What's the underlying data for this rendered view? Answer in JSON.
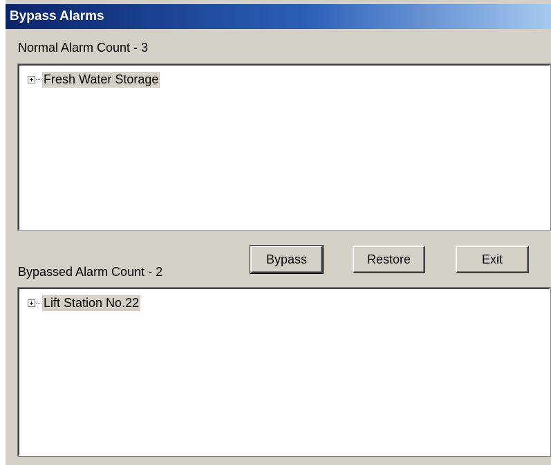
{
  "window": {
    "title": "Bypass Alarms"
  },
  "normal": {
    "label": "Normal Alarm Count - 3",
    "items": [
      {
        "label": "Fresh Water Storage"
      }
    ]
  },
  "bypassed": {
    "label": "Bypassed Alarm Count - 2",
    "items": [
      {
        "label": "Lift Station No.22"
      }
    ]
  },
  "buttons": {
    "bypass_label": "Bypass",
    "restore_label": "Restore",
    "exit_label": "Exit"
  },
  "colors": {
    "titlebar_start": "#0a246a",
    "titlebar_end": "#a6caf0",
    "face": "#d4d0c8",
    "selection_bg": "#d4d0c8"
  },
  "icons": {
    "tree_expander": "plus-box-icon"
  }
}
